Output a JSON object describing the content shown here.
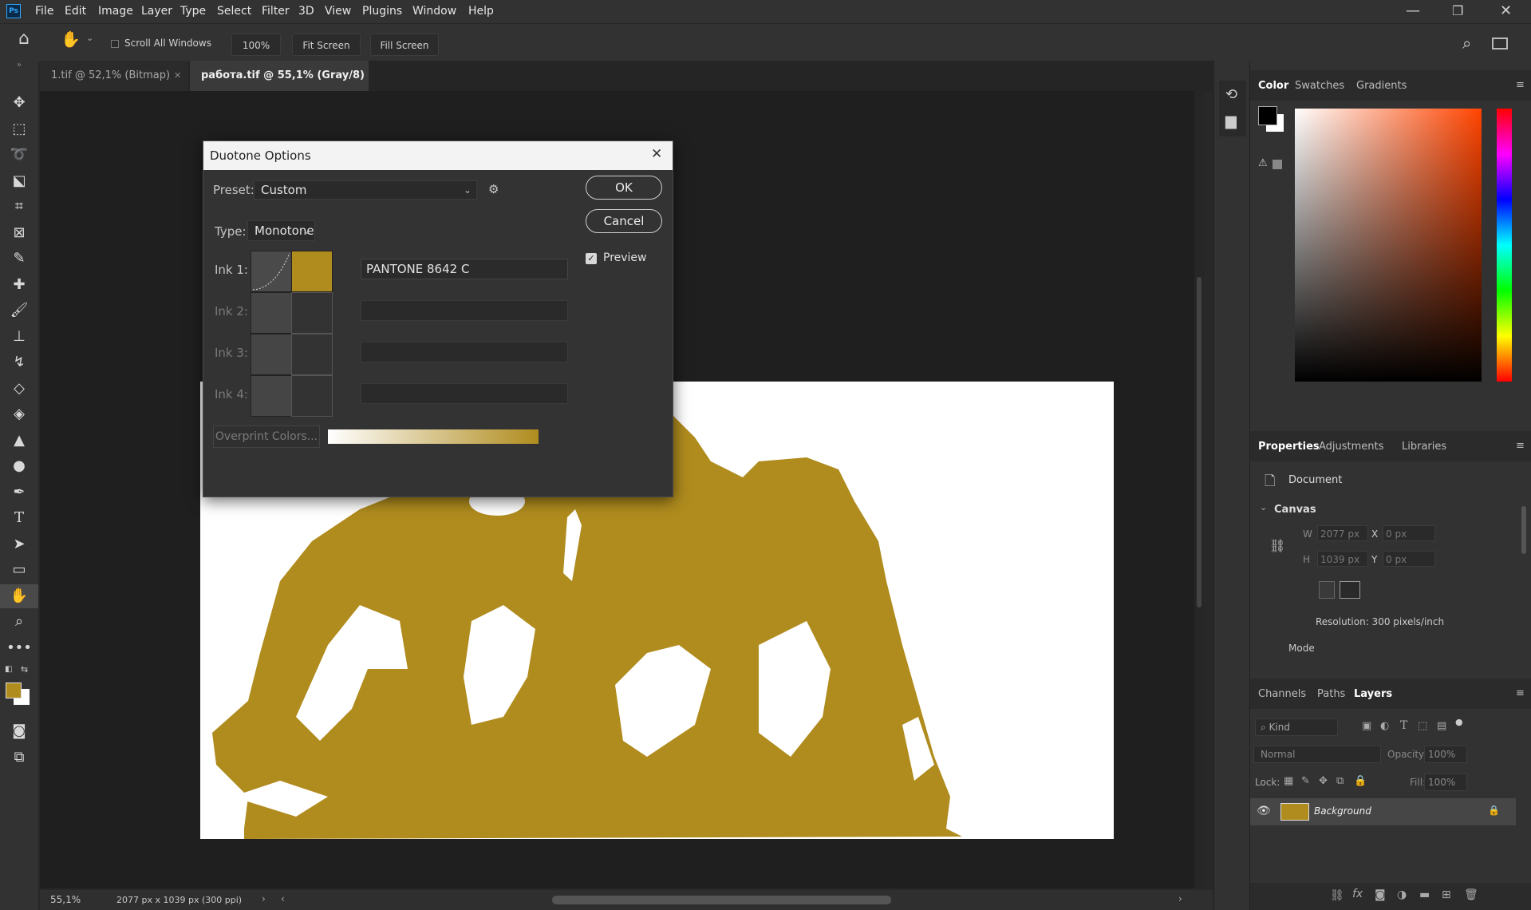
{
  "menubar": {
    "app_icon": "Ps",
    "items": [
      "File",
      "Edit",
      "Image",
      "Layer",
      "Type",
      "Select",
      "Filter",
      "3D",
      "View",
      "Plugins",
      "Window",
      "Help"
    ],
    "window_controls": [
      "minimize-icon",
      "restore-icon",
      "close-icon"
    ]
  },
  "options_bar": {
    "scroll_all_windows": "Scroll All Windows",
    "zoom_value": "100%",
    "fit_screen": "Fit Screen",
    "fill_screen": "Fill Screen"
  },
  "tabs": [
    {
      "label": "1.tif @ 52,1% (Bitmap)",
      "active": false
    },
    {
      "label": "работа.tif @ 55,1% (Gray/8) *",
      "active": true
    }
  ],
  "status": {
    "zoom": "55,1%",
    "doc_info": "2077 px x 1039 px (300 ppi)"
  },
  "dialog": {
    "title": "Duotone Options",
    "preset_label": "Preset:",
    "preset_value": "Custom",
    "type_label": "Type:",
    "type_value": "Monotone",
    "inks": [
      {
        "label": "Ink 1:",
        "name": "PANTONE 8642 C",
        "color": "#b08c1e",
        "enabled": true
      },
      {
        "label": "Ink 2:",
        "name": "",
        "color": "#333333",
        "enabled": false
      },
      {
        "label": "Ink 3:",
        "name": "",
        "color": "#333333",
        "enabled": false
      },
      {
        "label": "Ink 4:",
        "name": "",
        "color": "#333333",
        "enabled": false
      }
    ],
    "ok": "OK",
    "cancel": "Cancel",
    "preview_label": "Preview",
    "preview_checked": true,
    "overprint": "Overprint Colors..."
  },
  "color_panel": {
    "tabs": [
      "Color",
      "Swatches",
      "Gradients"
    ],
    "foreground": "#000000",
    "background": "#ffffff"
  },
  "properties_panel": {
    "tabs": [
      "Properties",
      "Adjustments",
      "Libraries"
    ],
    "document_label": "Document",
    "canvas_label": "Canvas",
    "w_label": "W",
    "w_value": "2077 px",
    "h_label": "H",
    "h_value": "1039 px",
    "x_label": "X",
    "x_value": "0 px",
    "y_label": "Y",
    "y_value": "0 px",
    "resolution": "Resolution: 300 pixels/inch",
    "mode_label": "Mode"
  },
  "layers_panel": {
    "tabs": [
      "Channels",
      "Paths",
      "Layers"
    ],
    "kind_label": "Kind",
    "blend_mode": "Normal",
    "opacity_label": "Opacity:",
    "opacity_value": "100%",
    "lock_label": "Lock:",
    "fill_label": "Fill:",
    "fill_value": "100%",
    "layer_name": "Background"
  },
  "colors": {
    "ink": "#b08c1e",
    "panel": "#323232"
  }
}
